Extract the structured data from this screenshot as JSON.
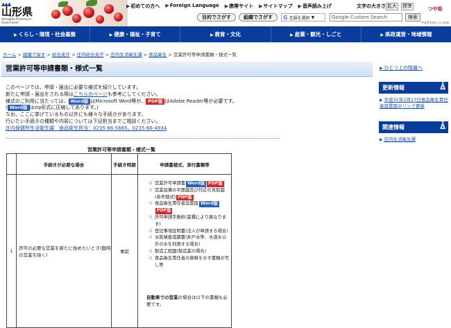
{
  "header": {
    "logo_text": "山形県",
    "logo_sub": "Yamagata Prefectural Government",
    "topnav": [
      {
        "label": "初めての方へ",
        "icon": "arrow-right-icon"
      },
      {
        "label": "Foreign Language",
        "icon": "globe-icon"
      },
      {
        "label": "携帯サイト",
        "icon": "arrow-right-icon"
      },
      {
        "label": "サイトマップ",
        "icon": "arrow-right-icon"
      },
      {
        "label": "音声読み上げ",
        "icon": "arrow-right-icon"
      }
    ],
    "textsize_label": "文字の大きさ",
    "enlarge": "拡大",
    "standard": "標準",
    "purpose_btn": "目的でさがす",
    "org_btn": "組織でさがす",
    "translate": "言語を選択",
    "search_placeholder": "Google Custom Search",
    "search_btn": "検索",
    "tsuyahime": "つや姫",
    "tsuyahime_sub": "やまがたおいしいもの"
  },
  "mainnav": [
    "くらし・環境・社会基盤",
    "健康・福祉・子育て",
    "教育・文化",
    "産業・観光・しごと",
    "県政運営・地域情報"
  ],
  "breadcrumb": [
    "ホーム",
    "組織で探す",
    "総合支庁",
    "庄内総合支庁",
    "庄内生活衛生課",
    "食品衛生",
    "営業許可等申請書類・様式一覧"
  ],
  "page_title": "営業許可等申請書類・様式一覧",
  "intro": {
    "l1": "このページでは、申請・届出に必要な様式を紹介しています。",
    "l2a": "新たに申請・届出をされる際は",
    "l2link": "こちらのページ",
    "l2b": "も参考にしてください。",
    "l3a": "様式のご利用に当たっては、",
    "word": "Word版",
    "l3b": "はMicrosoft Word等が、",
    "pdf": "PDF版",
    "l3c": "はAdobe Reader等が必要です。",
    "l4a": "(",
    "l4b": "はzip形式に圧縮してあります。)",
    "l5": "なお、ここに挙げているもの以外にも様々な手続きがあります。",
    "l6": "行いたい手続きの種類や内容については下記担当までご相談ください。",
    "contact": "庄内保健所生活衛生課　食品衛生担当：0235-66-5665、0235-66-4934"
  },
  "table": {
    "caption": "営業許可等申請書類・様式一覧",
    "headers": [
      "手続きが必要な場合",
      "手続き時期",
      "申請書様式、添付書類等"
    ],
    "row1": {
      "no": "1",
      "case": "許可の必要な営業を新たに始めたいとき(臨時の営業を除く)",
      "time": "事前",
      "docs": [
        {
          "text": "営業許可申請書",
          "badges": [
            "Word版",
            "PDF版"
          ]
        },
        {
          "text": "営業設備の平面図及び付近の見取図",
          "small": "(参考様式)",
          "badges": [
            "PDF版"
          ]
        },
        {
          "text": "食品衛生責任者設置届",
          "badges": [
            "Word版",
            "PDF版"
          ]
        },
        {
          "text": "許可申請手数料(業種により異なります)",
          "badges": []
        },
        {
          "text": "登記事項証明書(法人が申請する場合)",
          "badges": []
        },
        {
          "text": "水質検査成績書(井戸水等、水道水以外の水を利用する場合)",
          "badges": []
        },
        {
          "text": "製造工程図(製造業の場合)",
          "badges": []
        },
        {
          "text": "食品衛生責任者の資格を示す書類の写し等",
          "badges": []
        }
      ],
      "note_bold": "自動車での営業",
      "note_rest": "の場合は以下の書類も必要です。"
    }
  },
  "sidebar": {
    "back_link": "ひとつ上の階層へ",
    "news_title": "更新情報",
    "news_items": [
      "平成31年2月27日食品衛生責任者設置届のリンク更新"
    ],
    "related_title": "関連情報",
    "related_items": [
      "庄内生活衛生課"
    ]
  }
}
